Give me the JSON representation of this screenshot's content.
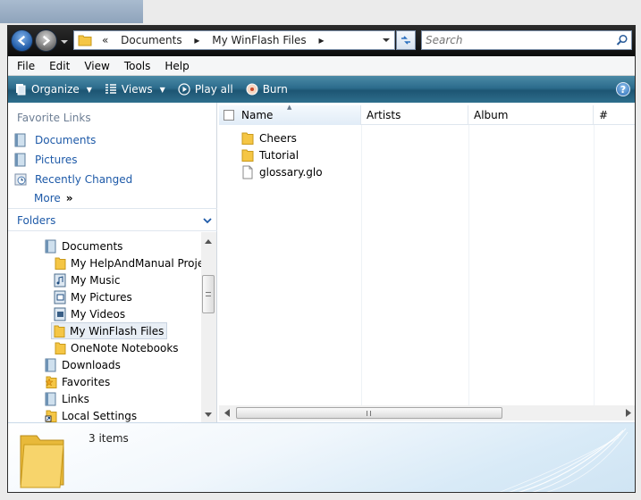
{
  "address": {
    "chevron": "«",
    "crumbs": [
      "Documents",
      "My WinFlash Files"
    ],
    "separator": "▸"
  },
  "search": {
    "placeholder": "Search"
  },
  "menu": [
    "File",
    "Edit",
    "View",
    "Tools",
    "Help"
  ],
  "toolbar": {
    "organize": "Organize",
    "views": "Views",
    "play_all": "Play all",
    "burn": "Burn",
    "help": "?"
  },
  "favorites": {
    "title": "Favorite Links",
    "links": [
      "Documents",
      "Pictures",
      "Recently Changed"
    ],
    "more": "More",
    "more_arrows": "»"
  },
  "folders": {
    "title": "Folders",
    "items": [
      {
        "label": "Documents",
        "icon": "documents-icon",
        "level": 1
      },
      {
        "label": "My HelpAndManual Projec",
        "icon": "folder-icon",
        "level": 2
      },
      {
        "label": "My Music",
        "icon": "music-folder-icon",
        "level": 2
      },
      {
        "label": "My Pictures",
        "icon": "pictures-folder-icon",
        "level": 2
      },
      {
        "label": "My Videos",
        "icon": "videos-folder-icon",
        "level": 2
      },
      {
        "label": "My WinFlash Files",
        "icon": "folder-icon",
        "level": 2,
        "selected": true
      },
      {
        "label": "OneNote Notebooks",
        "icon": "folder-icon",
        "level": 2
      },
      {
        "label": "Downloads",
        "icon": "downloads-icon",
        "level": 1
      },
      {
        "label": "Favorites",
        "icon": "favorites-icon",
        "level": 1
      },
      {
        "label": "Links",
        "icon": "links-icon",
        "level": 1
      },
      {
        "label": "Local Settings",
        "icon": "shortcut-folder-icon",
        "level": 1
      }
    ]
  },
  "columns": {
    "name": "Name",
    "artists": "Artists",
    "album": "Album",
    "number": "#"
  },
  "files": [
    {
      "name": "Cheers",
      "type": "folder"
    },
    {
      "name": "Tutorial",
      "type": "folder"
    },
    {
      "name": "glossary.glo",
      "type": "file"
    }
  ],
  "details": {
    "count": "3 items"
  },
  "colors": {
    "toolbar": "#2c6c8c",
    "link": "#1e5aa8",
    "folder": "#f5c645"
  }
}
